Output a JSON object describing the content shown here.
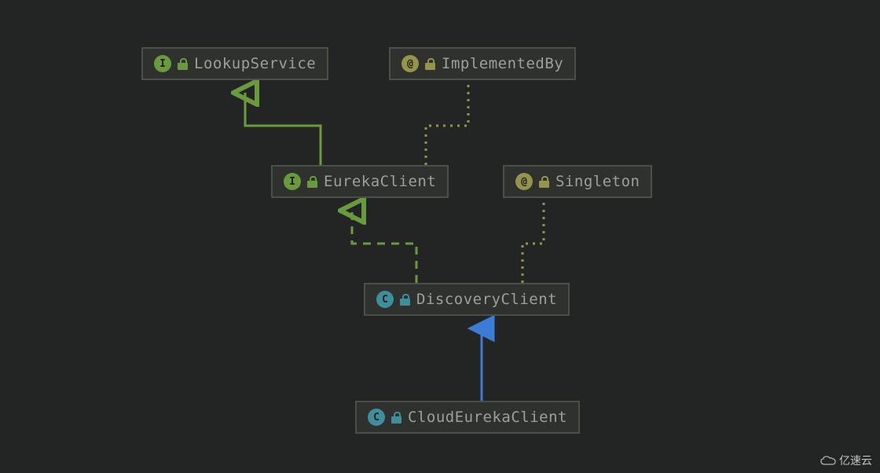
{
  "nodes": {
    "lookupService": {
      "label": "LookupService",
      "badge": "I",
      "kind": "interface"
    },
    "implementedBy": {
      "label": "ImplementedBy",
      "badge": "@",
      "kind": "annotation"
    },
    "eurekaClient": {
      "label": "EurekaClient",
      "badge": "I",
      "kind": "interface"
    },
    "singleton": {
      "label": "Singleton",
      "badge": "@",
      "kind": "annotation"
    },
    "discoveryClient": {
      "label": "DiscoveryClient",
      "badge": "C",
      "kind": "class"
    },
    "cloudEurekaClient": {
      "label": "CloudEurekaClient",
      "badge": "C",
      "kind": "class"
    }
  },
  "edges": [
    {
      "from": "eurekaClient",
      "to": "lookupService",
      "style": "solid-green",
      "meaning": "extends"
    },
    {
      "from": "eurekaClient",
      "to": "implementedBy",
      "style": "dotted-olive",
      "meaning": "annotated"
    },
    {
      "from": "discoveryClient",
      "to": "eurekaClient",
      "style": "dashed-green",
      "meaning": "implements"
    },
    {
      "from": "discoveryClient",
      "to": "singleton",
      "style": "dotted-olive",
      "meaning": "annotated"
    },
    {
      "from": "cloudEurekaClient",
      "to": "discoveryClient",
      "style": "solid-blue",
      "meaning": "extends"
    }
  ],
  "colors": {
    "interface": "#6a9a3e",
    "annotation": "#94944a",
    "class": "#3f8e9b",
    "extendsClass": "#3c7bd6"
  },
  "watermark": "亿速云"
}
